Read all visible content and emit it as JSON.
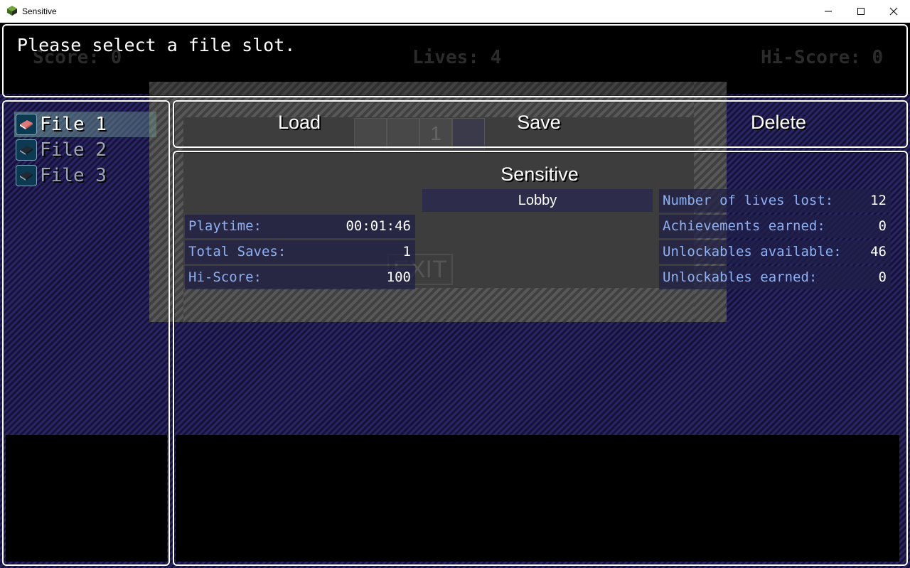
{
  "window": {
    "title": "Sensitive",
    "minimize": "─",
    "maximize": "☐",
    "close": "✕"
  },
  "hud": {
    "score": "Score: 0",
    "lives": "Lives: 4",
    "hiscore": "Hi-Score: 0"
  },
  "help": "Please select a file slot.",
  "files": [
    {
      "label": "File 1",
      "selected": true
    },
    {
      "label": "File 2",
      "selected": false
    },
    {
      "label": "File 3",
      "selected": false
    }
  ],
  "commands": {
    "load": "Load",
    "save": "Save",
    "delete": "Delete"
  },
  "preview": {
    "exit_label": "EXIT",
    "level_digit": "1"
  },
  "info": {
    "game_title": "Sensitive",
    "location": "Lobby",
    "left_stats": [
      {
        "label": "Playtime:",
        "value": "00:01:46"
      },
      {
        "label": "Total Saves:",
        "value": "1"
      },
      {
        "label": "Hi-Score:",
        "value": "100"
      }
    ],
    "right_stats": [
      {
        "label": "Number of lives lost:",
        "value": "12"
      },
      {
        "label": "Achievements earned:",
        "value": "0"
      },
      {
        "label": "Unlockables available:",
        "value": "46"
      },
      {
        "label": "Unlockables earned:",
        "value": "0"
      }
    ]
  },
  "colors": {
    "window_border": "#ffffff",
    "stat_label": "#8fb0f0",
    "selection": "#78aaa0",
    "background_stripe": "#2a2560"
  }
}
